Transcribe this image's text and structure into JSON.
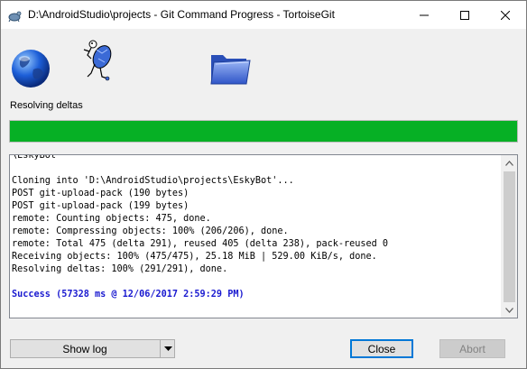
{
  "window": {
    "title": "D:\\AndroidStudio\\projects - Git Command Progress - TortoiseGit"
  },
  "icons": {
    "app": "tortoisegit-icon",
    "source": "globe-icon",
    "mascot": "tortoise-icon",
    "destination": "folder-icon"
  },
  "status": {
    "text": "Resolving deltas",
    "progress_fraction": 1.0,
    "progress_color": "#06b025"
  },
  "log": {
    "lines": [
      "\\EskyBot",
      "",
      "Cloning into 'D:\\AndroidStudio\\projects\\EskyBot'...",
      "POST git-upload-pack (190 bytes)",
      "POST git-upload-pack (199 bytes)",
      "remote: Counting objects: 475, done.",
      "remote: Compressing objects: 100% (206/206), done.",
      "remote: Total 475 (delta 291), reused 405 (delta 238), pack-reused 0",
      "Receiving objects: 100% (475/475), 25.18 MiB | 529.00 KiB/s, done.",
      "Resolving deltas: 100% (291/291), done.",
      ""
    ],
    "success": "Success (57328 ms @ 12/06/2017 2:59:29 PM)",
    "success_color": "#1a1ad0"
  },
  "buttons": {
    "show_log": "Show log",
    "close": "Close",
    "abort": "Abort"
  }
}
